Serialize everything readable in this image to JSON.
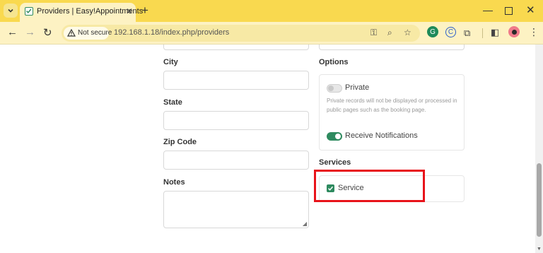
{
  "browser": {
    "tab_title": "Providers | Easy!Appointments",
    "close_glyph": "✕",
    "new_tab_glyph": "+",
    "security_label": "Not secure",
    "url": "192.168.1.18/index.php/providers"
  },
  "form": {
    "city_label": "City",
    "state_label": "State",
    "zip_label": "Zip Code",
    "notes_label": "Notes",
    "options_label": "Options",
    "private_label": "Private",
    "private_help": "Private records will not be displayed or processed in public pages such as the booking page.",
    "notifications_label": "Receive Notifications",
    "services_label": "Services",
    "service_item": "Service"
  },
  "state": {
    "private_enabled": false,
    "notifications_enabled": true,
    "service_checked": true
  },
  "colors": {
    "accent": "#2e8a5f",
    "highlight": "#e8131a",
    "tabbar": "#f9d94f"
  }
}
